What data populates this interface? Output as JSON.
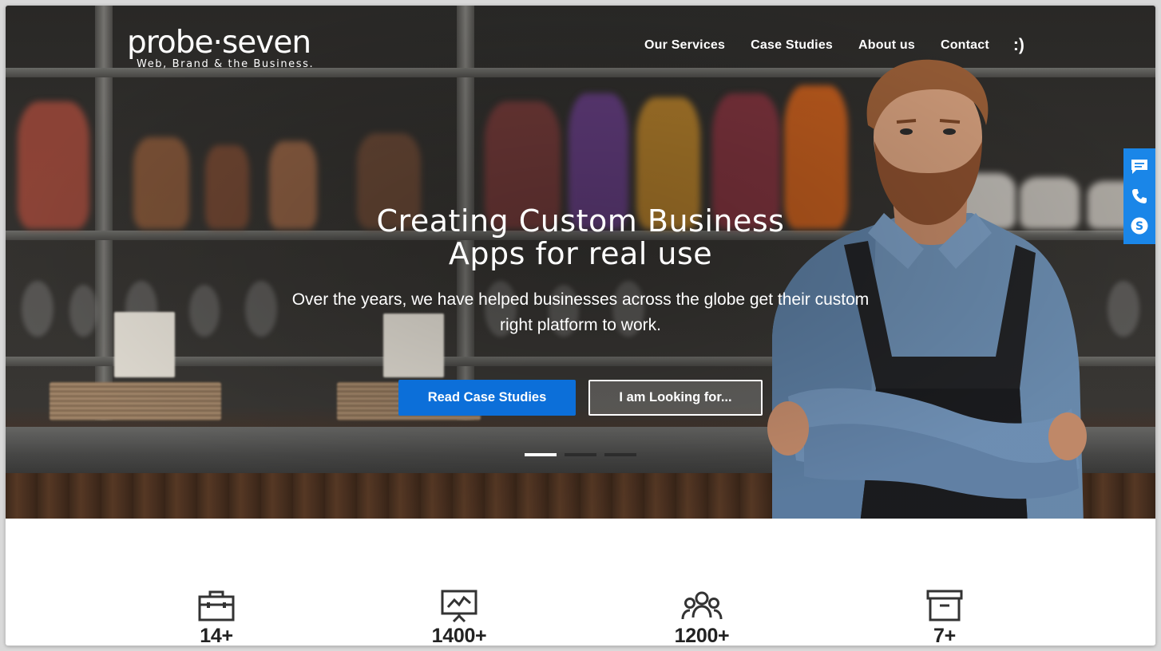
{
  "brand": {
    "logo_text": "probe·seven",
    "tagline": "Web, Brand & the Business."
  },
  "nav": {
    "items": [
      "Our Services",
      "Case Studies",
      "About us",
      "Contact"
    ],
    "extra": ":)"
  },
  "hero": {
    "headline_line1": "Creating Custom Business",
    "headline_line2": "Apps for real use",
    "subtext_line1": "Over the years, we have helped businesses across the globe get their custom",
    "subtext_line2": "right platform to work.",
    "primary_button": "Read Case Studies",
    "secondary_button": "I am Looking for...",
    "slides": {
      "count": 3,
      "active_index": 0
    }
  },
  "sidebar": {
    "icons": [
      "chat-icon",
      "phone-icon",
      "skype-icon"
    ],
    "color": "#1a86e8"
  },
  "stats": [
    {
      "icon": "briefcase-icon",
      "value": "14+"
    },
    {
      "icon": "presentation-chart-icon",
      "value": "1400+"
    },
    {
      "icon": "team-icon",
      "value": "1200+"
    },
    {
      "icon": "archive-box-icon",
      "value": "7+"
    }
  ],
  "colors": {
    "accent": "#0c6fd9",
    "text_on_hero": "#ffffff",
    "stat_text": "#222222"
  }
}
